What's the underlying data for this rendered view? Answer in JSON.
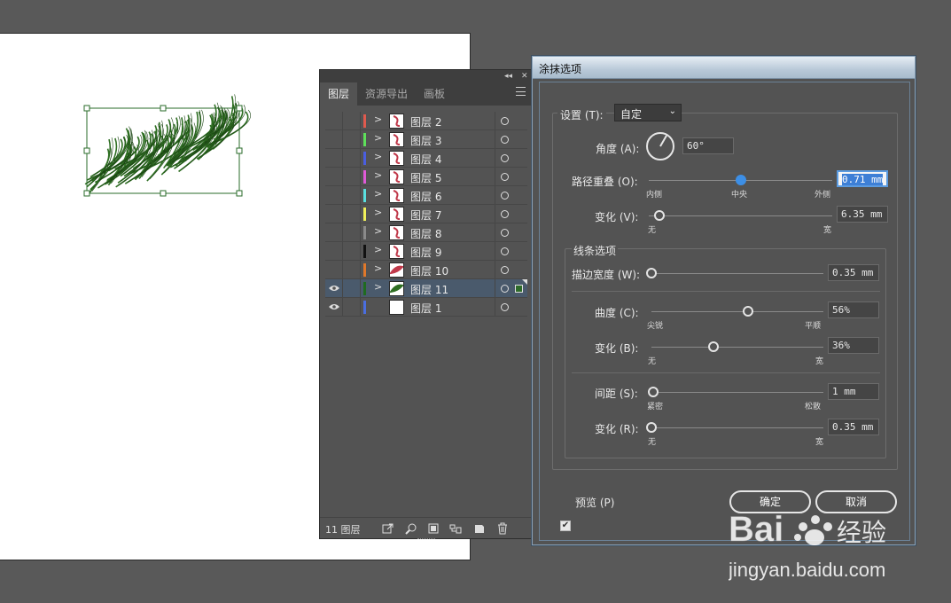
{
  "layers_panel": {
    "tabs": [
      "图层",
      "资源导出",
      "画板"
    ],
    "active_tab": 0,
    "collapse_glyph": "◂◂",
    "close_glyph": "✕",
    "layers": [
      {
        "name": "图层 2",
        "color": "#e05a4e",
        "visible": false,
        "expanded_arrow": true,
        "selected": false
      },
      {
        "name": "图层 3",
        "color": "#5ee05a",
        "visible": false,
        "expanded_arrow": true,
        "selected": false
      },
      {
        "name": "图层 4",
        "color": "#4a5ee0",
        "visible": false,
        "expanded_arrow": true,
        "selected": false
      },
      {
        "name": "图层 5",
        "color": "#e05ad8",
        "visible": false,
        "expanded_arrow": true,
        "selected": false
      },
      {
        "name": "图层 6",
        "color": "#5ae0e0",
        "visible": false,
        "expanded_arrow": true,
        "selected": false
      },
      {
        "name": "图层 7",
        "color": "#f0f05a",
        "visible": false,
        "expanded_arrow": true,
        "selected": false
      },
      {
        "name": "图层 8",
        "color": "#8a8a8a",
        "visible": false,
        "expanded_arrow": true,
        "selected": false
      },
      {
        "name": "图层 9",
        "color": "#111111",
        "visible": false,
        "expanded_arrow": true,
        "selected": false
      },
      {
        "name": "图层 10",
        "color": "#e0782a",
        "visible": false,
        "expanded_arrow": true,
        "selected": false
      },
      {
        "name": "图层 11",
        "color": "#1f6b1f",
        "visible": true,
        "expanded_arrow": true,
        "selected": true
      },
      {
        "name": "图层 1",
        "color": "#4a6ee0",
        "visible": true,
        "expanded_arrow": false,
        "selected": false
      }
    ],
    "footer_count": "11 图层"
  },
  "dialog": {
    "title": "涂抹选项",
    "settings_label": "设置 (T):",
    "preset_value": "自定",
    "angle_label": "角度 (A):",
    "angle_value": "60°",
    "angle_deg": 60,
    "path_overlap_label": "路径重叠 (O):",
    "path_overlap_value": "0.71 mm",
    "path_overlap_ticks": [
      "内侧",
      "中央",
      "外侧"
    ],
    "path_overlap_pos": 0.5,
    "path_var_label": "变化 (V):",
    "path_var_value": "6.35 mm",
    "path_var_ticks": [
      "无",
      "宽"
    ],
    "path_var_pos": 0.06,
    "line_options_label": "线条选项",
    "stroke_width_label": "描边宽度 (W):",
    "stroke_width_value": "0.35 mm",
    "stroke_width_pos": 0.0,
    "curviness_label": "曲度 (C):",
    "curviness_value": "56%",
    "curviness_ticks": [
      "尖锐",
      "平顺"
    ],
    "curviness_pos": 0.56,
    "curv_var_label": "变化 (B):",
    "curv_var_value": "36%",
    "curv_var_ticks": [
      "无",
      "宽"
    ],
    "curv_var_pos": 0.36,
    "spacing_label": "间距 (S):",
    "spacing_value": "1 mm",
    "spacing_ticks": [
      "紧密",
      "松散"
    ],
    "spacing_pos": 0.01,
    "spacing_var_label": "变化 (R):",
    "spacing_var_value": "0.35 mm",
    "spacing_var_ticks": [
      "无",
      "宽"
    ],
    "spacing_var_pos": 0.0,
    "preview_label": "预览 (P)",
    "preview_checked": true,
    "ok_label": "确定",
    "cancel_label": "取消"
  },
  "watermark": {
    "brand": "Bai",
    "brand_tail": "经验",
    "url": "jingyan.baidu.com"
  },
  "colors": {
    "scribble": "#2e6e22",
    "scribble_dark": "#1b4414",
    "dialog_bg": "#535353",
    "slider_active": "#3d8fe6"
  }
}
